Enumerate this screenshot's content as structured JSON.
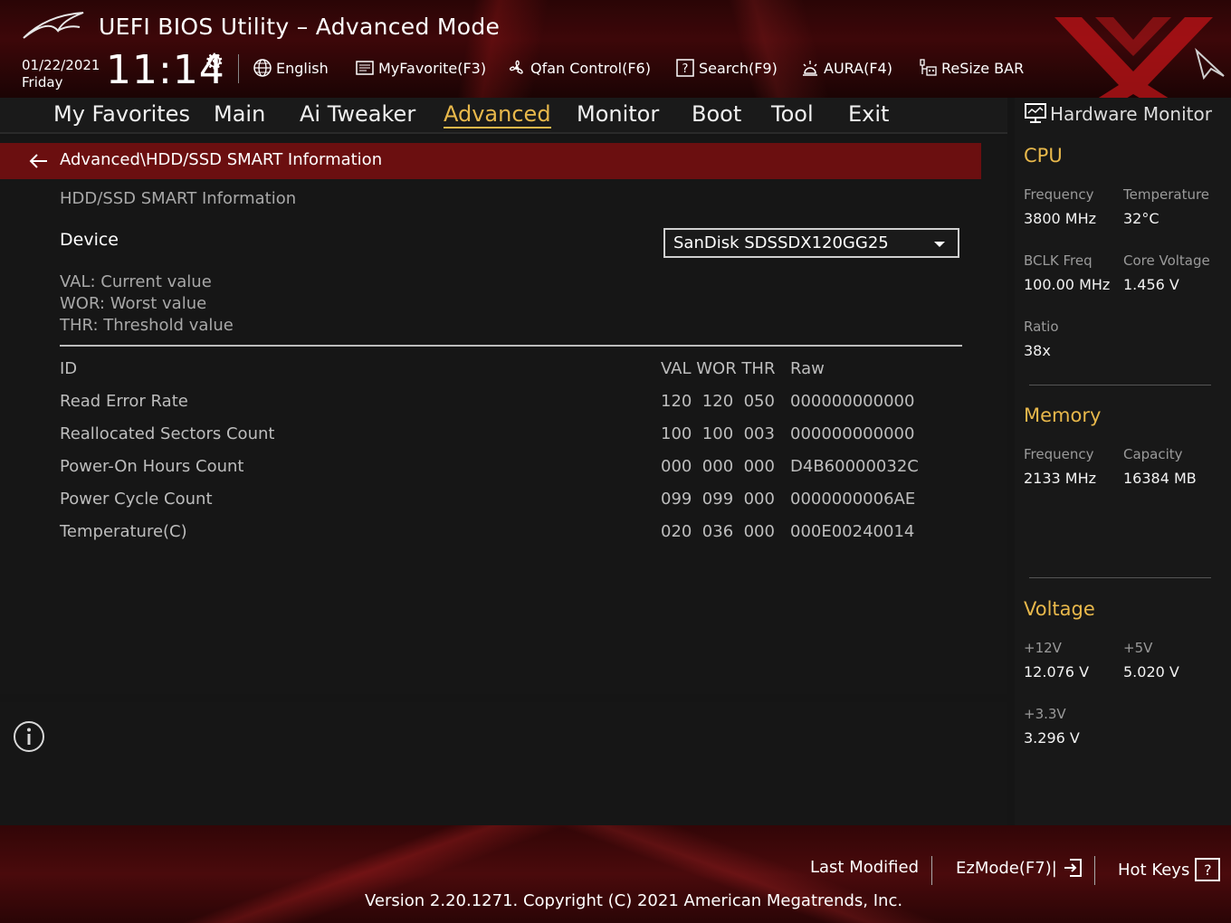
{
  "header": {
    "title": "UEFI BIOS Utility – Advanced Mode",
    "date": "01/22/2021",
    "day": "Friday",
    "time": "11:14",
    "tools": [
      {
        "label": "English",
        "icon": "globe-icon"
      },
      {
        "label": "MyFavorite(F3)",
        "icon": "favorite-list-icon"
      },
      {
        "label": "Qfan Control(F6)",
        "icon": "fan-icon"
      },
      {
        "label": "Search(F9)",
        "icon": "search-question-icon"
      },
      {
        "label": "AURA(F4)",
        "icon": "aura-light-icon"
      },
      {
        "label": "ReSize BAR",
        "icon": "resize-bar-icon"
      }
    ]
  },
  "nav": {
    "tabs": [
      "My Favorites",
      "Main",
      "Ai Tweaker",
      "Advanced",
      "Monitor",
      "Boot",
      "Tool",
      "Exit"
    ],
    "active": "Advanced"
  },
  "main": {
    "breadcrumb": "Advanced\\HDD/SSD SMART Information",
    "section_title": "HDD/SSD SMART Information",
    "device_label": "Device",
    "device_value": "SanDisk SDSSDX120GG25",
    "legend": [
      "VAL: Current value",
      "WOR: Worst value",
      "THR: Threshold value"
    ],
    "table": {
      "headers": {
        "id": "ID",
        "vals": "VAL WOR THR",
        "raw": "Raw"
      },
      "rows": [
        {
          "name": "Read Error Rate",
          "vals": "120  120  050",
          "raw": "000000000000"
        },
        {
          "name": "Reallocated Sectors Count",
          "vals": "100  100  003",
          "raw": "000000000000"
        },
        {
          "name": "Power-On Hours Count",
          "vals": "000  000  000",
          "raw": "D4B60000032C"
        },
        {
          "name": "Power Cycle Count",
          "vals": "099  099  000",
          "raw": "0000000006AE"
        },
        {
          "name": "Temperature(C)",
          "vals": "020  036  000",
          "raw": "000E00240014"
        }
      ]
    }
  },
  "hw": {
    "title": "Hardware Monitor",
    "cpu": {
      "heading": "CPU",
      "frequency_label": "Frequency",
      "frequency": "3800 MHz",
      "temperature_label": "Temperature",
      "temperature": "32°C",
      "bclk_label": "BCLK Freq",
      "bclk": "100.00 MHz",
      "core_voltage_label": "Core Voltage",
      "core_voltage": "1.456 V",
      "ratio_label": "Ratio",
      "ratio": "38x"
    },
    "memory": {
      "heading": "Memory",
      "frequency_label": "Frequency",
      "frequency": "2133 MHz",
      "capacity_label": "Capacity",
      "capacity": "16384 MB"
    },
    "voltage": {
      "heading": "Voltage",
      "v12_label": "+12V",
      "v12": "12.076 V",
      "v5_label": "+5V",
      "v5": "5.020 V",
      "v33_label": "+3.3V",
      "v33": "3.296 V"
    }
  },
  "footer": {
    "last_modified": "Last Modified",
    "ezmode": "EzMode(F7)|",
    "hotkeys": "Hot Keys",
    "hotkeys_key": "?",
    "version": "Version 2.20.1271. Copyright (C) 2021 American Megatrends, Inc."
  },
  "colors": {
    "accent": "#e8b84b",
    "breadcrumb_bg": "#6b0f10",
    "panel_bg": "#161616"
  }
}
